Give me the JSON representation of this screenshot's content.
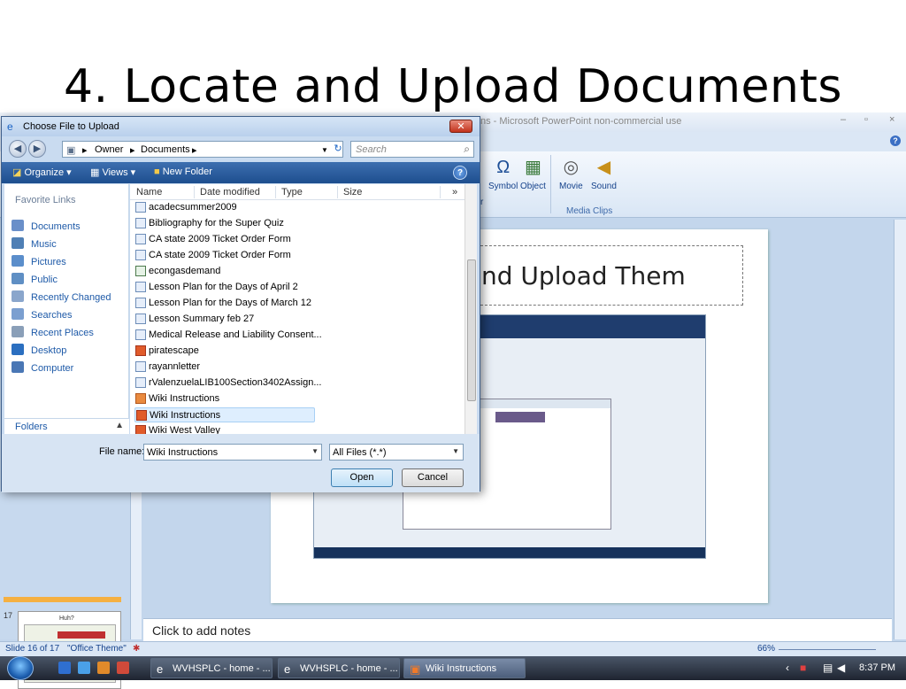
{
  "slide": {
    "title": "4. Locate and Upload Documents",
    "heading": "nd Upload Them",
    "notes_placeholder": "Click to add notes"
  },
  "ppt_window": {
    "title": "ns - Microsoft PowerPoint non-commercial use",
    "ribbon": {
      "symbol_label": "Symbol",
      "object_label": "Object",
      "movie_label": "Movie",
      "sound_label": "Sound",
      "media_group_label": "Media Clips",
      "partial_label": "r"
    },
    "thumbnail": {
      "number": "17",
      "text": "Huh?"
    }
  },
  "status_bar": {
    "slide_info": "Slide 16 of 17",
    "theme": "\"Office Theme\"",
    "zoom": "66%"
  },
  "taskbar": {
    "buttons": [
      {
        "label": "WVHSPLC - home - ...",
        "icon": "ie-icon"
      },
      {
        "label": "WVHSPLC - home - ...",
        "icon": "ie-icon"
      },
      {
        "label": "Wiki Instructions",
        "icon": "powerpoint-icon"
      }
    ],
    "clock": "8:37 PM"
  },
  "dialog": {
    "title": "Choose File to Upload",
    "breadcrumb": [
      "Owner",
      "Documents"
    ],
    "search_placeholder": "Search",
    "toolbar": {
      "organize": "Organize",
      "views": "Views",
      "new_folder": "New Folder"
    },
    "favorites_title": "Favorite Links",
    "favorites": [
      {
        "label": "Documents",
        "color": "#6a8fc9"
      },
      {
        "label": "Music",
        "color": "#4f7fb5"
      },
      {
        "label": "Pictures",
        "color": "#5b8ecb"
      },
      {
        "label": "Public",
        "color": "#5f8fc4"
      },
      {
        "label": "Recently Changed",
        "color": "#8aa6cc"
      },
      {
        "label": "Searches",
        "color": "#7b9fd0"
      },
      {
        "label": "Recent Places",
        "color": "#8a9fb8"
      },
      {
        "label": "Desktop",
        "color": "#2b6fc0"
      },
      {
        "label": "Computer",
        "color": "#4a77b5"
      }
    ],
    "folders_label": "Folders",
    "columns": {
      "name": "Name",
      "date_modified": "Date modified",
      "type": "Type",
      "size": "Size"
    },
    "files": [
      {
        "name": "acadecsummer2009",
        "icon": "doc"
      },
      {
        "name": "Bibliography for the Super Quiz",
        "icon": "doc"
      },
      {
        "name": "CA state 2009 Ticket Order Form",
        "icon": "doc"
      },
      {
        "name": "CA state 2009 Ticket Order Form",
        "icon": "doc"
      },
      {
        "name": "econgasdemand",
        "icon": "xls"
      },
      {
        "name": "Lesson Plan for the Days of April 2",
        "icon": "doc"
      },
      {
        "name": "Lesson Plan for the Days of March 12",
        "icon": "doc"
      },
      {
        "name": "Lesson Summary feb 27",
        "icon": "doc"
      },
      {
        "name": "Medical Release and Liability Consent...",
        "icon": "doc"
      },
      {
        "name": "piratescape",
        "icon": "pps"
      },
      {
        "name": "rayannletter",
        "icon": "doc"
      },
      {
        "name": "rValenzuelaLIB100Section3402Assign...",
        "icon": "doc"
      },
      {
        "name": "Wiki Instructions",
        "icon": "ppt"
      },
      {
        "name": "Wiki Instructions",
        "icon": "pps",
        "selected": true
      },
      {
        "name": "Wiki West Valley",
        "icon": "pps"
      }
    ],
    "file_name_label": "File name:",
    "file_name_value": "Wiki Instructions",
    "file_type_value": "All Files (*.*)",
    "open_label": "Open",
    "cancel_label": "Cancel"
  }
}
